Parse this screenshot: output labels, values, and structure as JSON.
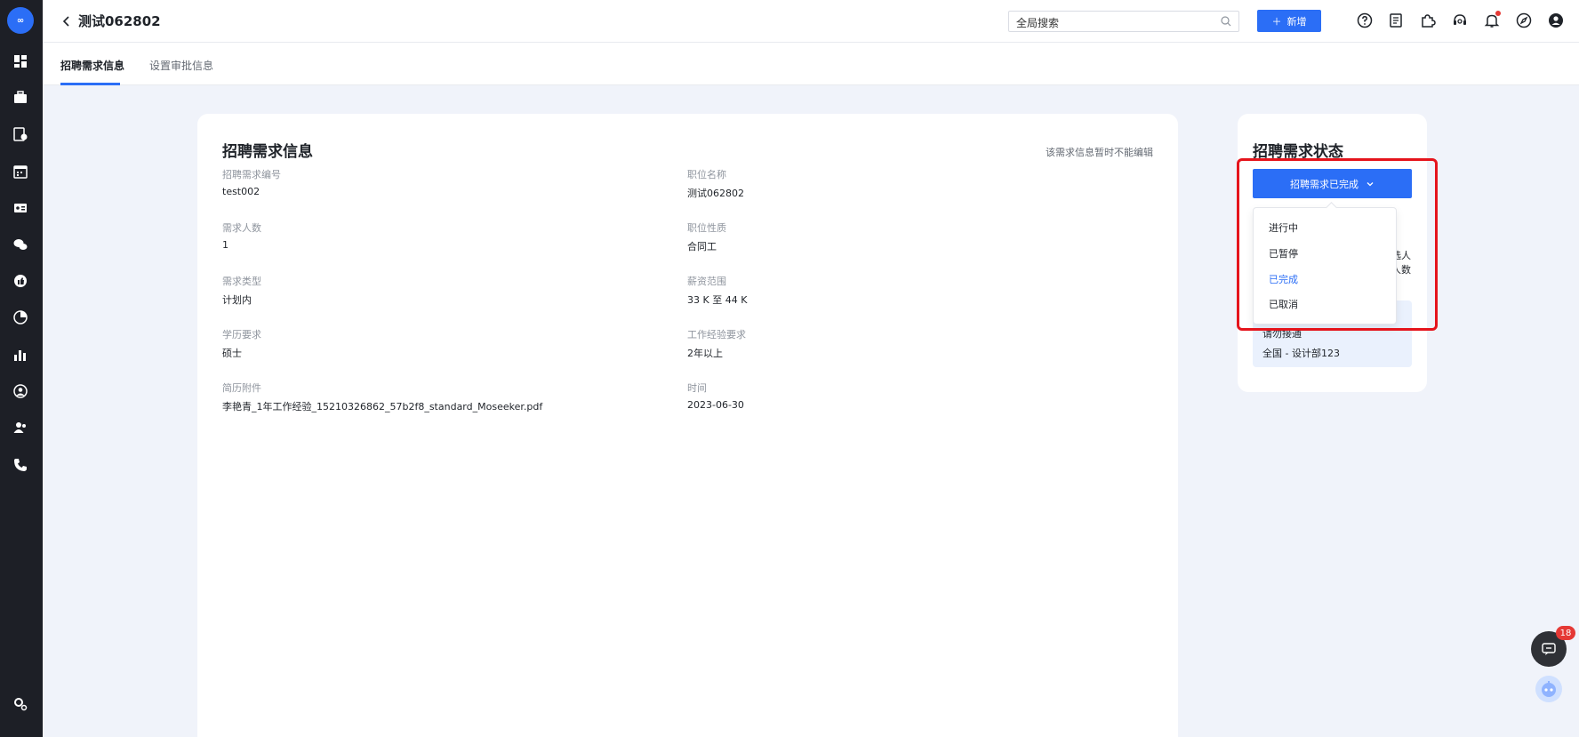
{
  "header": {
    "title": "测试062802",
    "search_placeholder": "全局搜索",
    "add_label": "新增"
  },
  "tabs": [
    {
      "label": "招聘需求信息"
    },
    {
      "label": "设置审批信息"
    }
  ],
  "main": {
    "title": "招聘需求信息",
    "note": "该需求信息暂时不能编辑",
    "fields": [
      {
        "label": "招聘需求编号",
        "value": "test002"
      },
      {
        "label": "职位名称",
        "value": "测试062802"
      },
      {
        "label": "需求人数",
        "value": "1"
      },
      {
        "label": "职位性质",
        "value": "合同工"
      },
      {
        "label": "需求类型",
        "value": "计划内"
      },
      {
        "label": "薪资范围",
        "value": "33 K 至 44 K"
      },
      {
        "label": "学历要求",
        "value": "硕士"
      },
      {
        "label": "工作经验要求",
        "value": "2年以上"
      },
      {
        "label": "简历附件",
        "value": "李艳青_1年工作经验_15210326862_57b2f8_standard_Moseeker.pdf"
      },
      {
        "label": "时间",
        "value": "2023-06-30"
      }
    ]
  },
  "status": {
    "title": "招聘需求状态",
    "button_label": "招聘需求已完成",
    "partial_1": "选人",
    "partial_2": "人数",
    "box_label": "请勿接通",
    "box_value": "全国 - 设计部123",
    "options": [
      "进行中",
      "已暂停",
      "已完成",
      "已取消"
    ],
    "selected_index": 2
  },
  "floating": {
    "chat_badge": "18"
  },
  "colors": {
    "accent": "#2b6ef6",
    "highlight": "#e5141c"
  }
}
